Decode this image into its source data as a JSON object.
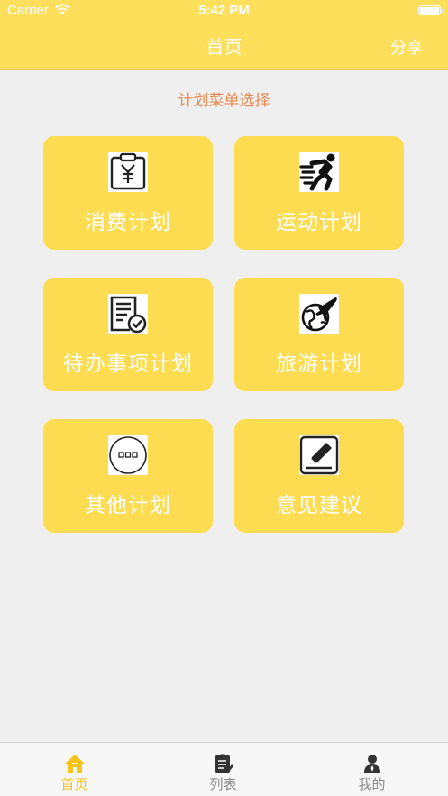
{
  "status_bar": {
    "carrier": "Carrier",
    "time": "5:42 PM"
  },
  "nav": {
    "title": "首页",
    "share_label": "分享"
  },
  "section_title": "计划菜单选择",
  "menu": [
    {
      "label": "消费计划",
      "icon": "receipt-yen-icon"
    },
    {
      "label": "运动计划",
      "icon": "running-person-icon"
    },
    {
      "label": "待办事项计划",
      "icon": "checklist-icon"
    },
    {
      "label": "旅游计划",
      "icon": "globe-plane-icon"
    },
    {
      "label": "其他计划",
      "icon": "more-dots-icon"
    },
    {
      "label": "意见建议",
      "icon": "edit-pencil-icon"
    }
  ],
  "tabs": [
    {
      "label": "首页",
      "icon": "home-icon",
      "active": true
    },
    {
      "label": "列表",
      "icon": "list-clipboard-icon",
      "active": false
    },
    {
      "label": "我的",
      "icon": "user-icon",
      "active": false
    }
  ],
  "colors": {
    "accent": "#fedc52",
    "active_tab": "#f5c518",
    "section_title": "#e8884e"
  }
}
